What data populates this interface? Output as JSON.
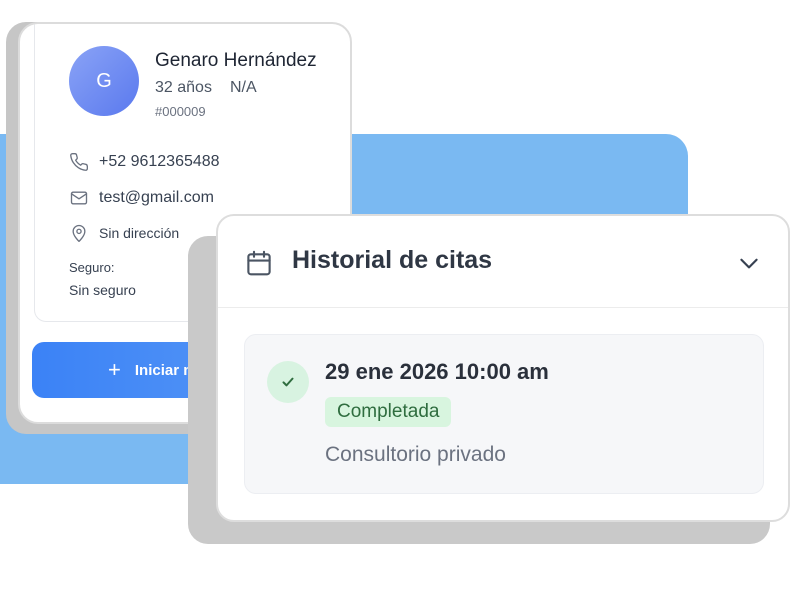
{
  "patient": {
    "avatar_initial": "G",
    "name": "Genaro Hernández",
    "age": "32 años",
    "gender": "N/A",
    "id": "#000009",
    "phone": "+52 9612365488",
    "email": "test@gmail.com",
    "address": "Sin dirección",
    "insurance_label": "Seguro:",
    "insurance_value": "Sin seguro",
    "start_button_label": "Iniciar nue"
  },
  "history": {
    "title": "Historial de citas",
    "appointments": [
      {
        "datetime": "29 ene 2026 10:00 am",
        "status": "Completada",
        "location": "Consultorio privado"
      }
    ]
  },
  "icons": {
    "phone": "phone-icon",
    "email": "mail-icon",
    "address": "map-pin-icon",
    "calendar": "calendar-icon",
    "chevron": "chevron-down-icon",
    "check": "check-icon",
    "plus": "plus-icon"
  },
  "colors": {
    "background_blue": "#7ab9f2",
    "accent_blue": "#3b82f6",
    "avatar_gradient": [
      "#8aa3f6",
      "#5a79ee"
    ],
    "status_green_bg": "#d8f5df",
    "status_green_text": "#2f6d3f"
  }
}
